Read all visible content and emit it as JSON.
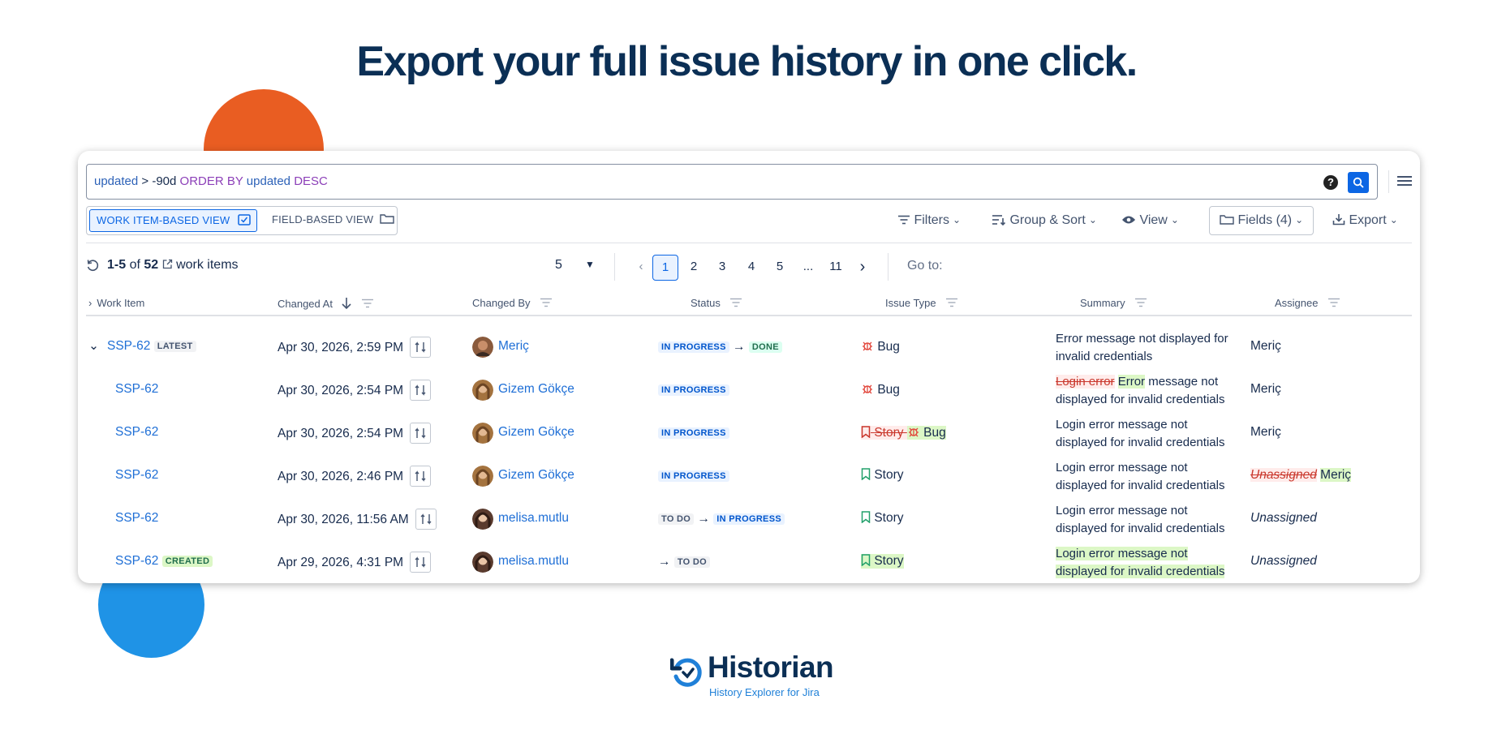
{
  "headline": "Export your full issue history in one click.",
  "query": {
    "field": "updated",
    "op": ">",
    "value": "-90d",
    "order_kw": "ORDER BY",
    "order_field": "updated",
    "order_dir": "DESC"
  },
  "toolbar": {
    "view_work_item": "WORK ITEM-BASED VIEW",
    "view_field": "FIELD-BASED VIEW",
    "filters": "Filters",
    "group_sort": "Group & Sort",
    "view": "View",
    "fields": "Fields (4)",
    "export": "Export"
  },
  "pager": {
    "range": "1-5",
    "of": "of",
    "total": "52",
    "suffix": "work items",
    "per_page": "5",
    "pages": [
      "1",
      "2",
      "3",
      "4",
      "5",
      "...",
      "11"
    ],
    "goto": "Go to:"
  },
  "columns": {
    "work_item": "Work Item",
    "changed_at": "Changed At",
    "changed_by": "Changed By",
    "status": "Status",
    "issue_type": "Issue Type",
    "summary": "Summary",
    "assignee": "Assignee"
  },
  "rows": [
    {
      "key": "SSP-62",
      "badge": "LATEST",
      "changed_at": "Apr 30, 2026, 2:59 PM",
      "changed_by": "Meriç",
      "status_from": "IN PROGRESS",
      "status_to": "DONE",
      "type": "Bug",
      "summary": "Error message not displayed for invalid credentials",
      "assignee": "Meriç"
    },
    {
      "key": "SSP-62",
      "changed_at": "Apr 30, 2026, 2:54 PM",
      "changed_by": "Gizem Gökçe",
      "status": "IN PROGRESS",
      "type": "Bug",
      "summary_del": "Login error",
      "summary_add": "Error",
      "summary_rest": "message not displayed for invalid credentials",
      "assignee": "Meriç"
    },
    {
      "key": "SSP-62",
      "changed_at": "Apr 30, 2026, 2:54 PM",
      "changed_by": "Gizem Gökçe",
      "status": "IN PROGRESS",
      "type_old": "Story",
      "type_new": "Bug",
      "summary": "Login error message not displayed for invalid credentials",
      "assignee": "Meriç"
    },
    {
      "key": "SSP-62",
      "changed_at": "Apr 30, 2026, 2:46 PM",
      "changed_by": "Gizem Gökçe",
      "status": "IN PROGRESS",
      "type": "Story",
      "summary": "Login error message not displayed for invalid credentials",
      "assignee_old": "Unassigned",
      "assignee_new": "Meriç"
    },
    {
      "key": "SSP-62",
      "changed_at": "Apr 30, 2026, 11:56 AM",
      "changed_by": "melisa.mutlu",
      "status_from": "TO DO",
      "status_to": "IN PROGRESS",
      "type": "Story",
      "summary": "Login error message not displayed for invalid credentials",
      "assignee": "Unassigned"
    },
    {
      "key": "SSP-62",
      "badge": "CREATED",
      "changed_at": "Apr 29, 2026, 4:31 PM",
      "changed_by": "melisa.mutlu",
      "status_to": "TO DO",
      "type": "Story",
      "summary": "Login error message not displayed for invalid credentials",
      "assignee": "Unassigned"
    }
  ],
  "logo": {
    "name": "Historian",
    "tagline": "History Explorer for Jira"
  },
  "colors": {
    "brand_navy": "#0b2f55",
    "accent_orange": "#e95d22",
    "accent_blue": "#1f93e6",
    "link_blue": "#1f6fd6"
  }
}
